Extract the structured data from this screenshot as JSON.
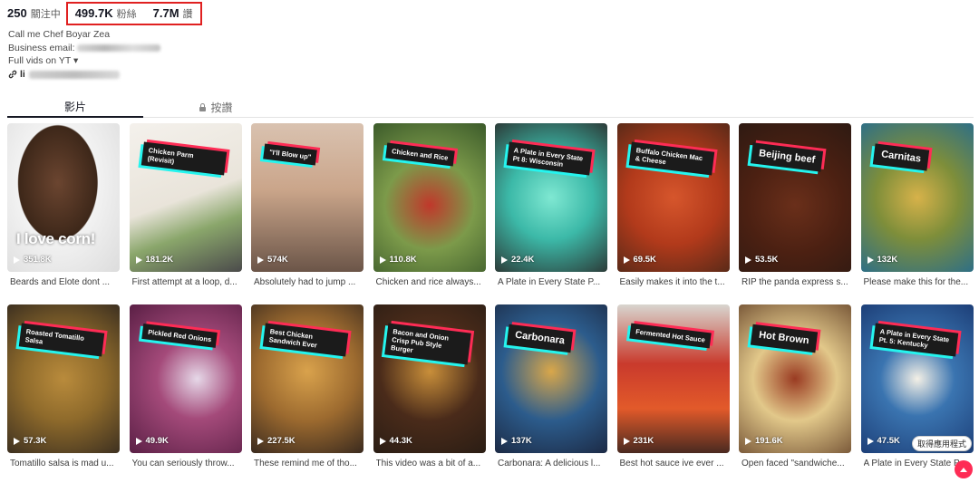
{
  "profile": {
    "following_count": "250",
    "following_label": "關注中",
    "followers_count": "499.7K",
    "followers_label": "粉絲",
    "likes_count": "7.7M",
    "likes_label": "讚",
    "bio_line1": "Call me Chef Boyar Zea",
    "bio_email_label": "Business email:",
    "bio_line3": "Full vids on YT",
    "bio_line3_marker": "▾",
    "link_prefix": "li"
  },
  "tabs": {
    "videos": "影片",
    "liked": "按讚"
  },
  "colors": {
    "accent_red": "#fe2c55",
    "accent_cyan": "#25f4ee",
    "highlight_box": "#e02020"
  },
  "videos": [
    {
      "views": "351.8K",
      "caption": "Beards and Elote dont ...",
      "overlay": "I love corn!",
      "label": ""
    },
    {
      "views": "181.2K",
      "caption": "First attempt at a loop, d...",
      "overlay": "",
      "label": "Chicken Parm (Revisit)"
    },
    {
      "views": "574K",
      "caption": "Absolutely had to jump ...",
      "overlay": "",
      "label": "\"I'll Blow up\""
    },
    {
      "views": "110.8K",
      "caption": "Chicken and rice always...",
      "overlay": "",
      "label": "Chicken and Rice"
    },
    {
      "views": "22.4K",
      "caption": "A Plate in Every State P...",
      "overlay": "",
      "label": "A Plate in Every State Pt 8: Wisconsin"
    },
    {
      "views": "69.5K",
      "caption": "Easily makes it into the t...",
      "overlay": "",
      "label": "Buffalo Chicken Mac & Cheese"
    },
    {
      "views": "53.5K",
      "caption": "RIP the panda express s...",
      "overlay": "",
      "label": "Beijing beef"
    },
    {
      "views": "132K",
      "caption": "Please make this for the...",
      "overlay": "",
      "label": "Carnitas"
    },
    {
      "views": "57.3K",
      "caption": "Tomatillo salsa is mad u...",
      "overlay": "",
      "label": "Roasted Tomatillo Salsa"
    },
    {
      "views": "49.9K",
      "caption": "You can seriously throw...",
      "overlay": "",
      "label": "Pickled Red Onions"
    },
    {
      "views": "227.5K",
      "caption": "These remind me of tho...",
      "overlay": "",
      "label": "Best Chicken Sandwich Ever"
    },
    {
      "views": "44.3K",
      "caption": "This video was a bit of a...",
      "overlay": "",
      "label": "Bacon and Onion Crisp Pub Style Burger"
    },
    {
      "views": "137K",
      "caption": "Carbonara: A delicious l...",
      "overlay": "",
      "label": "Carbonara"
    },
    {
      "views": "231K",
      "caption": "Best hot sauce ive ever ...",
      "overlay": "",
      "label": "Fermented Hot Sauce"
    },
    {
      "views": "191.6K",
      "caption": "Open faced \"sandwiche...",
      "overlay": "",
      "label": "Hot Brown"
    },
    {
      "views": "47.5K",
      "caption": "A Plate in Every State P...",
      "overlay": "",
      "label": "A Plate in Every State Pt. 5: Kentucky"
    }
  ],
  "floating": {
    "get_app": "取得應用程式"
  }
}
